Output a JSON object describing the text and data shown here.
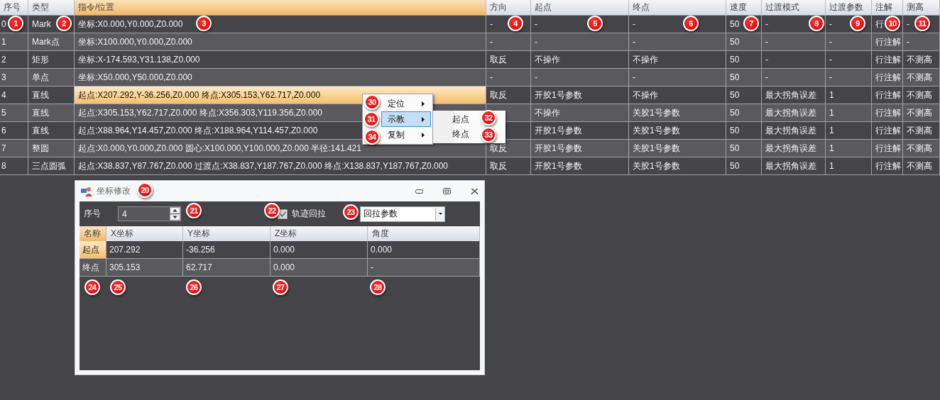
{
  "table": {
    "columns": [
      {
        "label": "序号",
        "selected": false
      },
      {
        "label": "类型",
        "selected": false
      },
      {
        "label": "指令/位置",
        "selected": true
      },
      {
        "label": "方向",
        "selected": false
      },
      {
        "label": "起点",
        "selected": false
      },
      {
        "label": "终点",
        "selected": false
      },
      {
        "label": "速度",
        "selected": false
      },
      {
        "label": "过渡模式",
        "selected": false
      },
      {
        "label": "过渡参数",
        "selected": false
      },
      {
        "label": "注解",
        "selected": false
      },
      {
        "label": "测高",
        "selected": false
      }
    ],
    "rows": [
      {
        "selected": false,
        "cells": [
          "0",
          "Mark",
          "坐标:X0.000,Y0.000,Z0.000",
          "-",
          "-",
          "-",
          "50",
          "-",
          "-",
          "行",
          "-"
        ]
      },
      {
        "selected": false,
        "cells": [
          "1",
          "Mark点",
          "坐标:X100.000,Y0.000,Z0.000",
          "-",
          "-",
          "-",
          "50",
          "-",
          "-",
          "行注解",
          "-"
        ]
      },
      {
        "selected": false,
        "cells": [
          "2",
          "矩形",
          "坐标:X-174.593,Y31.138,Z0.000",
          "取反",
          "不操作",
          "不操作",
          "50",
          "-",
          "-",
          "行注解",
          "不测高"
        ]
      },
      {
        "selected": false,
        "cells": [
          "3",
          "单点",
          "坐标:X50.000,Y50.000,Z0.000",
          "-",
          "-",
          "-",
          "50",
          "-",
          "-",
          "行注解",
          "不测高"
        ]
      },
      {
        "selected": true,
        "cells": [
          "4",
          "直线",
          "起点:X207.292,Y-36.256,Z0.000 终点:X305.153,Y62.717,Z0.000",
          "取反",
          "开胶1号参数",
          "不操作",
          "50",
          "最大拐角误差",
          "1",
          "行注解",
          "不测高"
        ]
      },
      {
        "selected": false,
        "cells": [
          "5",
          "直线",
          "起点:X305.153,Y62.717,Z0.000 终点:X356.303,Y119.356,Z0.000",
          null,
          "不操作",
          "关胶1号参数",
          "50",
          "最大拐角误差",
          "1",
          "行注解",
          "不测高"
        ]
      },
      {
        "selected": false,
        "cells": [
          "6",
          "直线",
          "起点:X88.964,Y14.457,Z0.000 终点:X188.964,Y114.457,Z0.000",
          null,
          "开胶1号参数",
          "关胶1号参数",
          "50",
          "最大拐角误差",
          "1",
          "行注解",
          "不测高"
        ]
      },
      {
        "selected": false,
        "cells": [
          "7",
          "整圆",
          "起点:X0.000,Y0.000,Z0.000 圆心:X100.000,Y100.000,Z0.000 半径:141.421",
          "取反",
          "开胶1号参数",
          "关胶1号参数",
          "50",
          "最大拐角误差",
          "1",
          "行注解",
          "不测高"
        ]
      },
      {
        "selected": false,
        "cells": [
          "8",
          "三点圆弧",
          "起点:X38.837,Y87.767,Z0.000 过渡点:X38.837,Y187.767,Z0.000 终点:X138.837,Y187.767,Z0.000",
          "取反",
          "开胶1号参数",
          "关胶1号参数",
          "50",
          "最大拐角误差",
          "1",
          "行注解",
          "不测高"
        ]
      }
    ]
  },
  "context_menu": {
    "items": [
      {
        "label": "定位",
        "selected": false
      },
      {
        "label": "示教",
        "selected": true,
        "children": [
          {
            "label": "起点"
          },
          {
            "label": "终点"
          }
        ]
      },
      {
        "label": "复制",
        "selected": false
      }
    ]
  },
  "dialog": {
    "title": "坐标修改",
    "index_label": "序号",
    "index_value": "4",
    "checkbox": {
      "label": "轨迹回拉",
      "checked": true
    },
    "combo_value": "回拉参数",
    "columns": [
      {
        "label": "名称",
        "selected": true
      },
      {
        "label": "X坐标",
        "selected": false
      },
      {
        "label": "Y坐标",
        "selected": false
      },
      {
        "label": "Z坐标",
        "selected": false
      },
      {
        "label": "角度",
        "selected": false
      }
    ],
    "rows": [
      {
        "selected": true,
        "cells": [
          "起点",
          "207.292",
          "-36.256",
          "0.000",
          "0.000"
        ]
      },
      {
        "selected": false,
        "cells": [
          "终点",
          "305.153",
          "62.717",
          "0.000",
          "-"
        ]
      }
    ]
  },
  "callouts": [
    {
      "number": "1"
    },
    {
      "number": "2"
    },
    {
      "number": "3"
    },
    {
      "number": "4"
    },
    {
      "number": "5"
    },
    {
      "number": "6"
    },
    {
      "number": "7"
    },
    {
      "number": "8"
    },
    {
      "number": "9"
    },
    {
      "number": "10"
    },
    {
      "number": "11"
    },
    {
      "number": "30"
    },
    {
      "number": "31"
    },
    {
      "number": "34"
    },
    {
      "number": "32"
    },
    {
      "number": "33"
    },
    {
      "number": "20"
    },
    {
      "number": "21"
    },
    {
      "number": "22"
    },
    {
      "number": "23"
    },
    {
      "number": "24"
    },
    {
      "number": "25"
    },
    {
      "number": "26"
    },
    {
      "number": "27"
    },
    {
      "number": "28"
    }
  ]
}
